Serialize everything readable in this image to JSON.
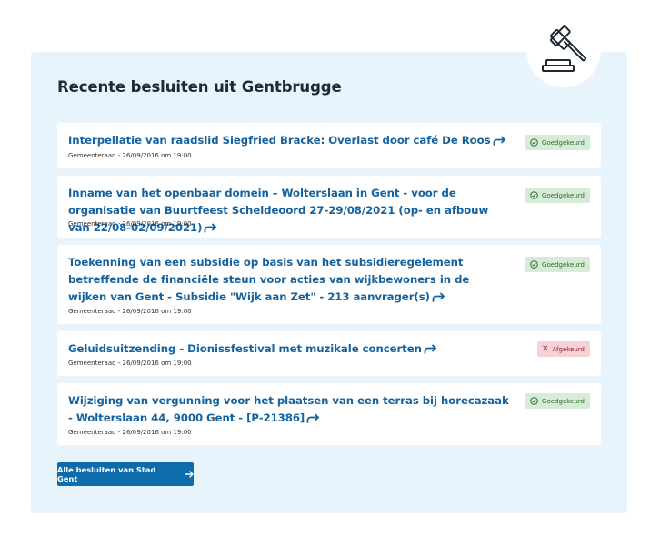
{
  "page": {
    "title": "Recente besluiten uit Gentbrugge",
    "icon": "gavel-icon"
  },
  "decisions": [
    {
      "title": "Interpellatie van raadslid Siegfried Bracke: Overlast door café De Roos",
      "meta": "Gemeenteraad - 26/09/2016 om 19:00",
      "status": "Goedgekeurd",
      "status_type": "approved"
    },
    {
      "title": "Inname van het openbaar domein – Wolterslaan in Gent - voor de organisatie van Buurtfeest Scheldeoord 27-29/08/2021 (op- en afbouw van 22/08-02/09/2021)",
      "meta": "Gemeenteraad - 26/09/2016 om 19:00",
      "status": "Goedgekeurd",
      "status_type": "approved"
    },
    {
      "title": "Toekenning van een subsidie op basis van het subsidieregelement betreffende de financiële steun voor acties van wijkbewoners in de wijken van Gent - Subsidie \"Wijk aan Zet\" - 213 aanvrager(s)",
      "meta": "Gemeenteraad - 26/09/2016 om 19:00",
      "status": "Goedgekeurd",
      "status_type": "approved"
    },
    {
      "title": "Geluidsuitzending - Dionissfestival met muzikale concerten",
      "meta": "Gemeenteraad - 26/09/2016 om 19:00",
      "status": "Afgekeurd",
      "status_type": "rejected"
    },
    {
      "title": "Wijziging van vergunning voor het plaatsen van een terras bij horecazaak - Wolterslaan 44, 9000 Gent - [P-21386]",
      "meta": "Gemeenteraad - 26/09/2016 om 19:00",
      "status": "Goedgekeurd",
      "status_type": "approved"
    }
  ],
  "cta": {
    "label": "Alle besluiten van Stad Gent",
    "icon": "arrow-right-icon"
  },
  "colors": {
    "panel_bg": "#e8f4fc",
    "link": "#15629e",
    "button": "#0e6bac",
    "approved_bg": "#d6ecd6",
    "rejected_bg": "#f6d2d6"
  }
}
